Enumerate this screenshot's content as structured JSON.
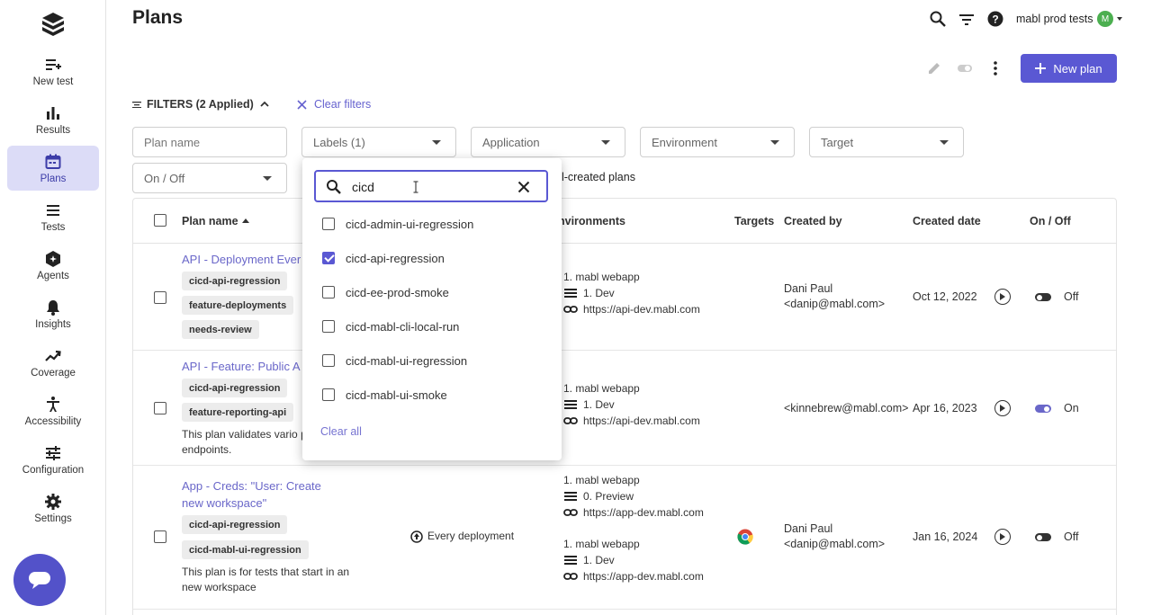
{
  "sidebar": {
    "items": [
      {
        "label": "New test",
        "icon": "new-test-icon"
      },
      {
        "label": "Results",
        "icon": "results-icon"
      },
      {
        "label": "Plans",
        "icon": "plans-icon",
        "active": true
      },
      {
        "label": "Tests",
        "icon": "tests-icon"
      },
      {
        "label": "Agents",
        "icon": "agents-icon"
      },
      {
        "label": "Insights",
        "icon": "bell-icon"
      },
      {
        "label": "Coverage",
        "icon": "trend-icon"
      },
      {
        "label": "Accessibility",
        "icon": "accessibility-icon"
      },
      {
        "label": "Configuration",
        "icon": "sliders-icon"
      },
      {
        "label": "Settings",
        "icon": "gear-icon"
      }
    ]
  },
  "header": {
    "title": "Plans",
    "user": "mabl prod tests",
    "avatar_letter": "M",
    "new_plan_label": "New plan"
  },
  "filters": {
    "label": "FILTERS (2 Applied)",
    "clear_label": "Clear filters",
    "plan_name_placeholder": "Plan name",
    "labels": "Labels (1)",
    "application": "Application",
    "environment": "Environment",
    "target": "Target",
    "on_off": "On / Off",
    "mabl_created_partial": "bl-created plans"
  },
  "dropdown": {
    "search_value": "cicd",
    "options": [
      {
        "label": "cicd-admin-ui-regression",
        "checked": false
      },
      {
        "label": "cicd-api-regression",
        "checked": true
      },
      {
        "label": "cicd-ee-prod-smoke",
        "checked": false
      },
      {
        "label": "cicd-mabl-cli-local-run",
        "checked": false
      },
      {
        "label": "cicd-mabl-ui-regression",
        "checked": false
      },
      {
        "label": "cicd-mabl-ui-smoke",
        "checked": false
      }
    ],
    "clear_all": "Clear all"
  },
  "table": {
    "headers": {
      "plan_name": "Plan name",
      "environments": "nvironments",
      "targets": "Targets",
      "created_by": "Created by",
      "created_date": "Created date",
      "on_off": "On / Off"
    },
    "rows": [
      {
        "name": "API - Deployment Ever",
        "labels": [
          "cicd-api-regression",
          "feature-deployments",
          "needs-review"
        ],
        "env": [
          {
            "app": "1. mabl webapp",
            "env": "1. Dev",
            "url": "https://api-dev.mabl.com"
          }
        ],
        "created_by_1": "Dani Paul",
        "created_by_2": "<danip@mabl.com>",
        "date": "Oct 12, 2022",
        "state": "Off"
      },
      {
        "name": "API - Feature: Public A",
        "labels": [
          "cicd-api-regression",
          "feature-reporting-api"
        ],
        "desc": "This plan validates vario public API endpoints.",
        "env": [
          {
            "app": "1. mabl webapp",
            "env": "1. Dev",
            "url": "https://api-dev.mabl.com"
          }
        ],
        "created_by_1": "<kinnebrew@mabl.com>",
        "date": "Apr 16, 2023",
        "state": "On"
      },
      {
        "name": "App - Creds: \"User: Create new workspace\"",
        "labels": [
          "cicd-api-regression",
          "cicd-mabl-ui-regression"
        ],
        "desc": "This plan is for tests that start in an new workspace",
        "trigger": "Every deployment",
        "env": [
          {
            "app": "1. mabl webapp",
            "env": "0. Preview",
            "url": "https://app-dev.mabl.com"
          },
          {
            "app": "1. mabl webapp",
            "env": "1. Dev",
            "url": "https://app-dev.mabl.com"
          }
        ],
        "created_by_1": "Dani Paul",
        "created_by_2": "<danip@mabl.com>",
        "date": "Jan 16, 2024",
        "state": "Off"
      }
    ]
  }
}
